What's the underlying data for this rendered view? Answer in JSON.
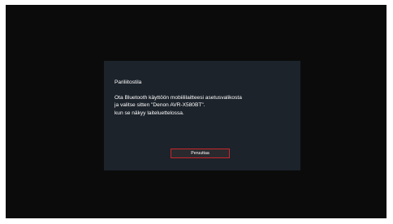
{
  "dialog": {
    "title": "Pariliitostila",
    "message_lines": [
      "Ota Bluetooth käyttöön mobiililaitteesi asetusvalikosta",
      "ja valitse sitten \"Denon AVR-X580BT\".",
      "kun se näkyy laiteluettelossa."
    ],
    "cancel_label": "Peruuttaa"
  },
  "colors": {
    "screen_background": "#0b0b0b",
    "dialog_background": "#1c232b",
    "button_border": "#c8262c",
    "text": "#ffffff"
  }
}
